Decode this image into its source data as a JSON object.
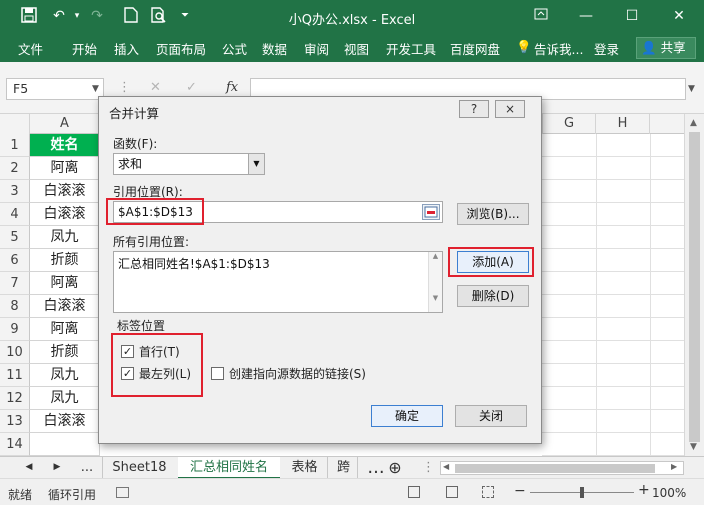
{
  "window": {
    "title": "小Q办公.xlsx - Excel",
    "quick_access": [
      "save-icon",
      "undo-icon",
      "redo-icon",
      "new-icon",
      "print-preview-icon",
      "customize-icon"
    ],
    "controls": [
      "ribbon-options-icon",
      "minimize-icon",
      "maximize-icon",
      "close-icon"
    ]
  },
  "ribbon": {
    "tabs": [
      "文件",
      "开始",
      "插入",
      "页面布局",
      "公式",
      "数据",
      "审阅",
      "视图",
      "开发工具",
      "百度网盘"
    ],
    "tell_me": "告诉我...",
    "login": "登录",
    "share": "共享"
  },
  "formula_bar": {
    "name_box": "F5",
    "fx": "fx",
    "value": ""
  },
  "grid": {
    "columns": [
      "A",
      "G",
      "H"
    ],
    "rows": [
      "1",
      "2",
      "3",
      "4",
      "5",
      "6",
      "7",
      "8",
      "9",
      "10",
      "11",
      "12",
      "13",
      "14"
    ],
    "column_a": [
      "姓名",
      "阿离",
      "白滚滚",
      "白滚滚",
      "凤九",
      "折颜",
      "阿离",
      "白滚滚",
      "阿离",
      "折颜",
      "凤九",
      "凤九",
      "白滚滚",
      ""
    ],
    "header_fill": "#00b050"
  },
  "dialog": {
    "title": "合并计算",
    "help": "?",
    "close": "×",
    "function_label": "函数(F):",
    "function_value": "求和",
    "ref_label": "引用位置(R):",
    "ref_value": "$A$1:$D$13",
    "browse": "浏览(B)...",
    "all_refs_label": "所有引用位置:",
    "all_refs": [
      "汇总相同姓名!$A$1:$D$13"
    ],
    "add": "添加(A)",
    "delete": "删除(D)",
    "labels_group": "标签位置",
    "first_row": {
      "label": "首行(T)",
      "checked": true
    },
    "left_column": {
      "label": "最左列(L)",
      "checked": true
    },
    "create_links": {
      "label": "创建指向源数据的链接(S)",
      "checked": false
    },
    "ok": "确定",
    "cancel": "关闭",
    "highlight_color": "#e0202e"
  },
  "sheets": {
    "more_left": "...",
    "tabs": [
      "Sheet18",
      "汇总相同姓名",
      "表格",
      "跨"
    ],
    "active": "汇总相同姓名",
    "more_right": "..."
  },
  "status": {
    "ready": "就绪",
    "circular": "循环引用",
    "zoom": "100%",
    "zoom_level": 1.0
  },
  "colors": {
    "excel_green": "#217346"
  }
}
